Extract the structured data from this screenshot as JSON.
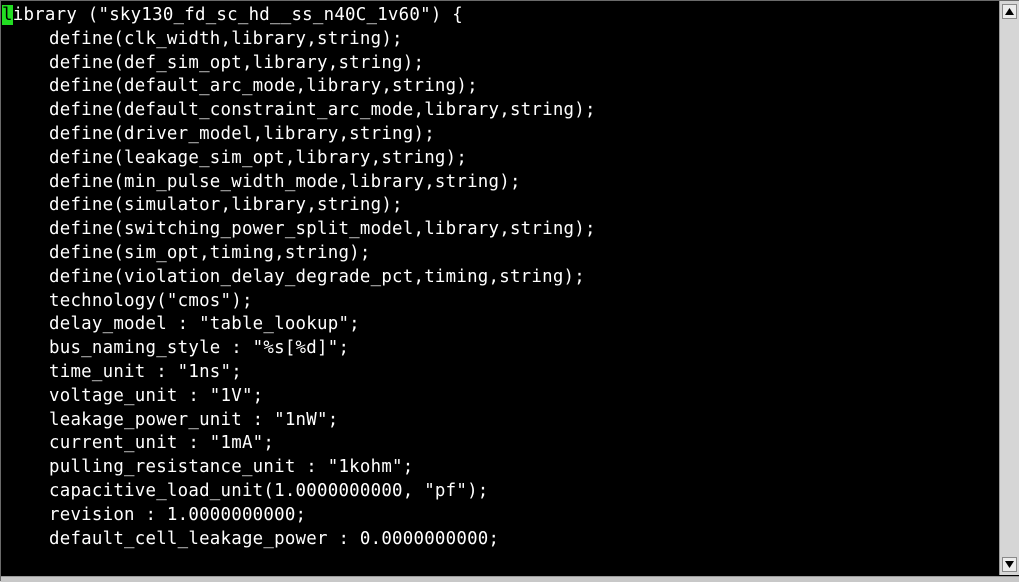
{
  "terminal": {
    "first_line_cursor_char": "l",
    "first_line_rest": "ibrary (\"sky130_fd_sc_hd__ss_n40C_1v60\") {",
    "lines": [
      "define(clk_width,library,string);",
      "define(def_sim_opt,library,string);",
      "define(default_arc_mode,library,string);",
      "define(default_constraint_arc_mode,library,string);",
      "define(driver_model,library,string);",
      "define(leakage_sim_opt,library,string);",
      "define(min_pulse_width_mode,library,string);",
      "define(simulator,library,string);",
      "define(switching_power_split_model,library,string);",
      "define(sim_opt,timing,string);",
      "define(violation_delay_degrade_pct,timing,string);",
      "technology(\"cmos\");",
      "delay_model : \"table_lookup\";",
      "bus_naming_style : \"%s[%d]\";",
      "time_unit : \"1ns\";",
      "voltage_unit : \"1V\";",
      "leakage_power_unit : \"1nW\";",
      "current_unit : \"1mA\";",
      "pulling_resistance_unit : \"1kohm\";",
      "capacitive_load_unit(1.0000000000, \"pf\");",
      "revision : 1.0000000000;",
      "default_cell_leakage_power : 0.0000000000;"
    ]
  },
  "colors": {
    "background": "#000000",
    "foreground": "#ffffff",
    "cursor": "#22dd22"
  },
  "scrollbar": {
    "up_icon": "arrow-up-icon",
    "down_icon": "arrow-down-icon"
  }
}
